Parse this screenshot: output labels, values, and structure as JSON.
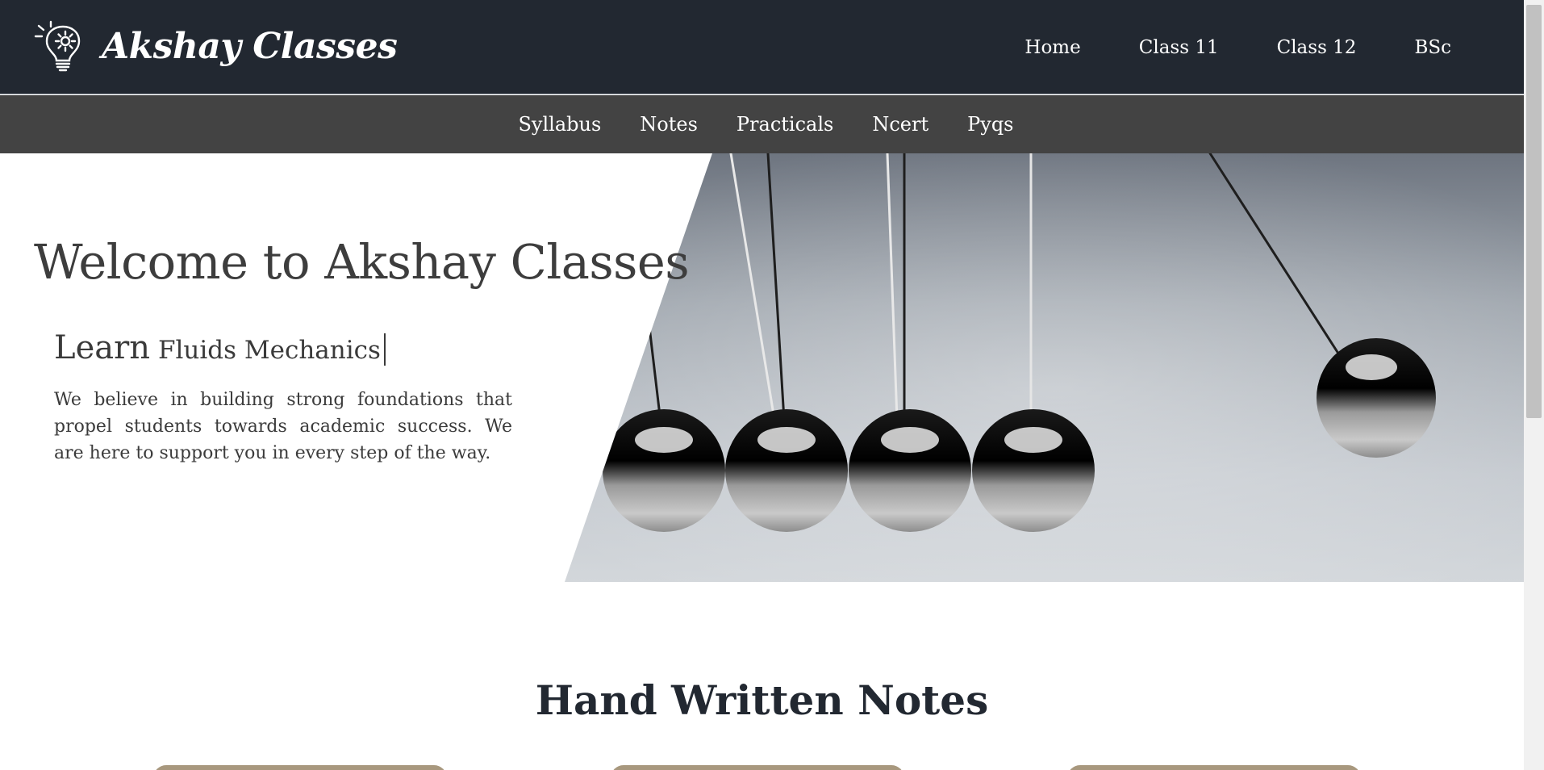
{
  "brand": {
    "name": "Akshay Classes",
    "logo_icon": "lightbulb-gear-icon"
  },
  "main_nav": [
    "Home",
    "Class 11",
    "Class 12",
    "BSc"
  ],
  "sub_nav": [
    "Syllabus",
    "Notes",
    "Practicals",
    "Ncert",
    "Pyqs"
  ],
  "hero": {
    "title": "Welcome to Akshay Classes",
    "subtitle_prefix": "Learn",
    "subtitle_typed": "Fluids Mechanics",
    "description": "We believe in building strong foundations that propel students towards academic success. We are here to support you in every step of the way.",
    "image": "newtons-cradle-image"
  },
  "notes": {
    "heading": "Hand Written Notes"
  },
  "colors": {
    "topbar": "#222831",
    "subbar": "#434343",
    "text_dark": "#3d3d3d",
    "card_top": "#a8987e"
  }
}
